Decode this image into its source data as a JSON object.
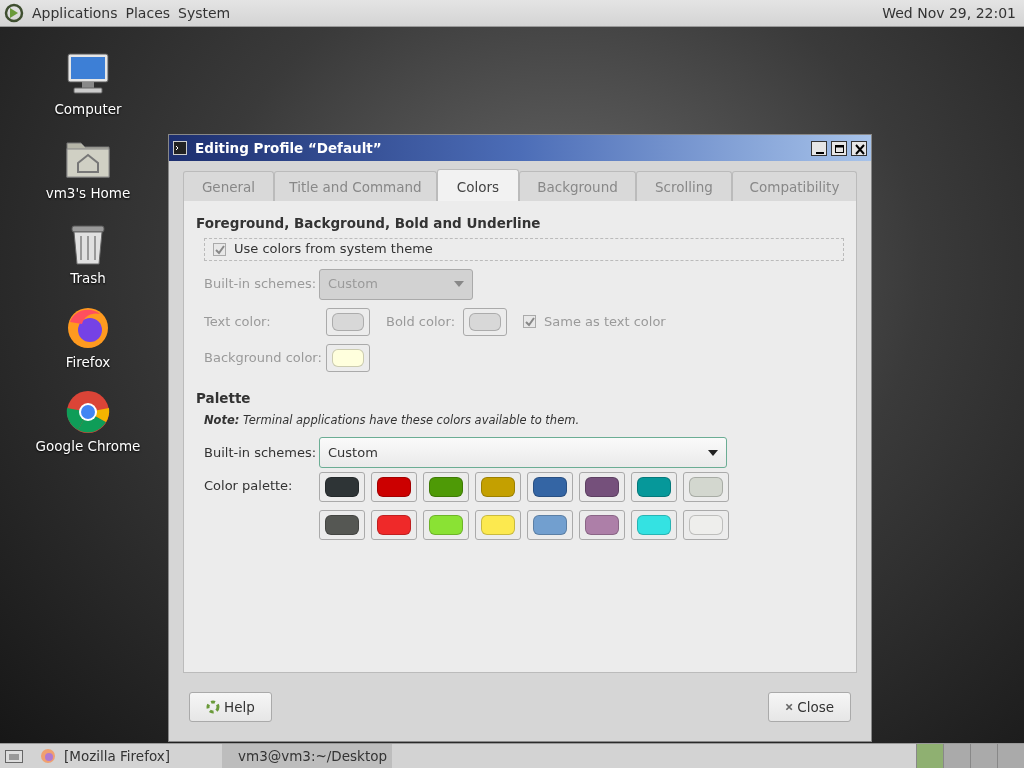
{
  "top_panel": {
    "menus": [
      "Applications",
      "Places",
      "System"
    ],
    "clock": "Wed Nov 29, 22:01"
  },
  "desktop_icons": [
    {
      "label": "Computer",
      "kind": "computer"
    },
    {
      "label": "vm3's Home",
      "kind": "home"
    },
    {
      "label": "Trash",
      "kind": "trash"
    },
    {
      "label": "Firefox",
      "kind": "firefox"
    },
    {
      "label": "Google Chrome",
      "kind": "chrome"
    }
  ],
  "window": {
    "title": "Editing Profile “Default”",
    "tabs": [
      {
        "label": "General",
        "selected": false
      },
      {
        "label": "Title and Command",
        "selected": false
      },
      {
        "label": "Colors",
        "selected": true
      },
      {
        "label": "Background",
        "selected": false
      },
      {
        "label": "Scrolling",
        "selected": false
      },
      {
        "label": "Compatibility",
        "selected": false
      }
    ],
    "foreground": {
      "heading": "Foreground, Background, Bold and Underline",
      "use_system_colors": {
        "label": "Use colors from system theme",
        "checked": true
      },
      "disabled": true,
      "schemes": {
        "label": "Built-in schemes:",
        "value": "Custom"
      },
      "text_color": {
        "label": "Text color:",
        "color": "#d8d8d8"
      },
      "bold_color": {
        "label": "Bold color:",
        "color": "#d8d8d8"
      },
      "same_as_text": {
        "label": "Same as text color",
        "checked": true
      },
      "background_color": {
        "label": "Background color:",
        "color": "#ffffdd"
      }
    },
    "palette": {
      "heading": "Palette",
      "note": "**Note:** Terminal applications have these colors available to them.",
      "schemes": {
        "label": "Built-in schemes:",
        "value": "Custom"
      },
      "palette_label": "Color palette:",
      "colors": [
        {
          "color": "#2e3436"
        },
        {
          "color": "#cc0000"
        },
        {
          "color": "#4e9a06"
        },
        {
          "color": "#c4a000"
        },
        {
          "color": "#3465a4"
        },
        {
          "color": "#75507b"
        },
        {
          "color": "#06989a"
        },
        {
          "color": "#d3d7cf"
        },
        {
          "color": "#555753"
        },
        {
          "color": "#ef2929"
        },
        {
          "color": "#8ae234"
        },
        {
          "color": "#fce94f"
        },
        {
          "color": "#729fcf"
        },
        {
          "color": "#ad7fa8"
        },
        {
          "color": "#34e2e2"
        },
        {
          "color": "#eeeeec"
        }
      ]
    },
    "buttons": [
      {
        "label": "Help",
        "kind": "help"
      },
      {
        "label": "Close",
        "kind": "close"
      }
    ]
  },
  "taskbar": {
    "items": [
      {
        "label": "[Mozilla Firefox]",
        "kind": "browser",
        "selected": false
      },
      {
        "label": "vm3@vm3:~/Desktop",
        "kind": "terminal",
        "selected": true
      }
    ],
    "workspaces": [
      {
        "selected": true
      },
      {
        "selected": false
      },
      {
        "selected": false
      },
      {
        "selected": false
      }
    ]
  }
}
